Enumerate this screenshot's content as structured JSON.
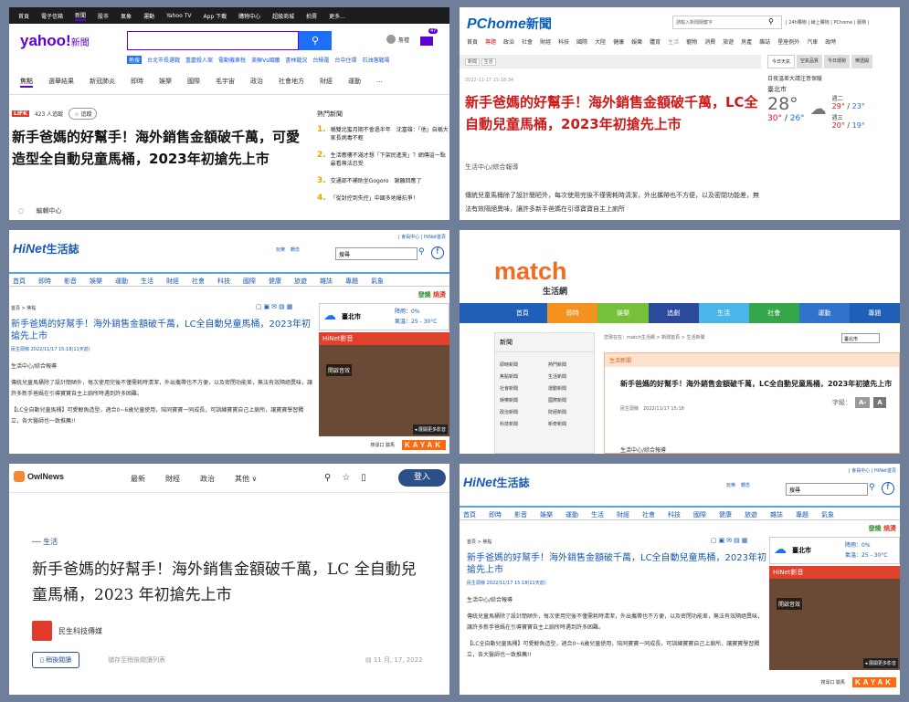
{
  "headline": "新手爸媽的好幫手！海外銷售金額破千萬，LC全自動兒童馬桶，2023年初搶先上市",
  "yahoo": {
    "topbar": [
      "首頁",
      "電子信箱",
      "新聞",
      "股市",
      "氣象",
      "運動",
      "Yahoo TV",
      "App 下載",
      "購物中心",
      "超級商城",
      "拍賣",
      "更多..."
    ],
    "logo": "yahoo!",
    "logo_sub": "新聞",
    "search_icon": "search-icon",
    "quick_hot": "熱搜",
    "quick_links": [
      "台北市長選戰",
      "重慶殺人案",
      "電動機車稅",
      "美聯Vs國鵬",
      "書林戰況",
      "台積電",
      "台中住環",
      "石油落戰場"
    ],
    "user": "詹禮",
    "mail_badge": "47",
    "nav": [
      "焦點",
      "選舉結果",
      "新冠肺炎",
      "即時",
      "娛樂",
      "國際",
      "毛宇宙",
      "政治",
      "社會地方",
      "財經",
      "運動",
      "..."
    ],
    "brand": "LIFK",
    "reads": "423 人追蹤",
    "follow": "☆ 追蹤",
    "title": "新手爸媽的好幫手！海外銷售金額破千萬，可愛造型全自動兒童馬桶，2023年初搶先上市",
    "hot_header": "熱門新聞",
    "hot": [
      {
        "n": "1.",
        "t": "稱雙北蜜月期不會過半年　沈富雄：「他」自稱大家長病毒不輕"
      },
      {
        "n": "2.",
        "t": "生活應樓不滿才想「下架民進黨」？網傳這一點最看無法忍受"
      },
      {
        "n": "3.",
        "t": "交通部不補助坐Gogoro　謝願回應了"
      },
      {
        "n": "4.",
        "t": "「從封控到失控」中國多地爆抗爭！"
      }
    ],
    "editor": "編輯中心"
  },
  "pchome": {
    "logo": "PChome",
    "logo_sub": "新聞",
    "search_placeholder": "請輸入新聞關鍵字",
    "toplinks": "| 24h購物 | 線上購物 | PChome | 服務 |",
    "nav": [
      "首頁",
      "專題",
      "政治",
      "社會",
      "財經",
      "科技",
      "國際",
      "大陸",
      "健康",
      "娛樂",
      "體育",
      "生活",
      "寵物",
      "消費",
      "旅遊",
      "房產",
      "雜誌",
      "星座例外",
      "汽車",
      "政時"
    ],
    "bread": [
      "新聞",
      "生活"
    ],
    "date": "2022-11-17 15:18:34",
    "title": "新手爸媽的好幫手！海外銷售金額破千萬，LC全自動兒童馬桶，2023年初搶先上市",
    "source": "生活中心/綜合報導",
    "body": "傳統兒童馬桶除了設計簡陋外，每次使用完後不僅需耗時清潔，外出攜帶也不方便，以及密閉功能差，無法有效隔絕異味，讓許多新手爸媽在引導寶寶自主上廁所",
    "wtabs": [
      "今日天氣",
      "空氣品質",
      "今日運勢",
      "樂透開"
    ],
    "wx_note": "日夜溫差大請注意保暖",
    "city": "臺北市",
    "temp": "28°",
    "range_hi": "30°",
    "range_lo": "26°",
    "d2": "週二",
    "d2_hi": "29°",
    "d2_lo": "23°",
    "d3": "週三",
    "d3_hi": "20°",
    "d3_lo": "19°"
  },
  "hinet": {
    "logo": "HiNet",
    "logo_sub": "生活誌",
    "toplinks": "| 會員中心 | HiNet首頁",
    "fun": "玩樂",
    "xfer": "轉念",
    "search": "搜尋",
    "nav": [
      "首頁",
      "即時",
      "影音",
      "娛樂",
      "運動",
      "生活",
      "財經",
      "社會",
      "科技",
      "國際",
      "健康",
      "旅遊",
      "雜誌",
      "專題",
      "氣象"
    ],
    "green": [
      "發燒",
      "燒燙"
    ],
    "bread": "首頁 > 焦點",
    "title": "新手爸媽的好幫手！海外銷售金額破千萬，LC全自動兒童馬桶，2023年初搶先上市",
    "date": "民生頭條 2022/11/17 15:18(11天前)",
    "src": "生活中心/綜合報導",
    "body1": "傳統兒童馬桶除了設計簡陋外，每次使用完後不僅需耗時清潔，外出攜帶也不方便，以及密閉功能差，無法有效隔絕異味，讓許多新手爸媽在引導寶寶自主上廁所時遇到許多困難。",
    "body2": "【LC全自動兒童馬桶】可愛鯨魚造型，適合0~6歲兒童使用，陪同寶寶一同成長，可訓練寶寶自己上廁所，讓寶寶學習獨立，各大醫師也一致推薦!!",
    "wx_city": "臺北市",
    "wx_rain": "降雨：0%",
    "wx_temp": "氣溫：25 - 30°C",
    "video_header": "HiNet影音",
    "video_label": "開啟音效",
    "video_more": "◂ 展開更多影音",
    "ad": "KAYAK",
    "ad_note": "搜尋口 驗馬"
  },
  "match": {
    "logo": "match",
    "logo_sub": "生活網",
    "nav": [
      {
        "t": "首頁",
        "c": "#1f5fb8"
      },
      {
        "t": "即時",
        "c": "#f4921f"
      },
      {
        "t": "娛樂",
        "c": "#77c03a"
      },
      {
        "t": "追劇",
        "c": "#2c4a9b"
      },
      {
        "t": "生活",
        "c": "#4ab5e8"
      },
      {
        "t": "社會",
        "c": "#35a64a"
      },
      {
        "t": "運動",
        "c": "#2f73cc"
      },
      {
        "t": "專題",
        "c": "#1f5fb8"
      }
    ],
    "left_header": "新聞",
    "left_items": [
      "即時新聞",
      "熱門新聞",
      "焦點新聞",
      "生活新聞",
      "社會新聞",
      "運動新聞",
      "娛樂新聞",
      "國際新聞",
      "政治新聞",
      "財經新聞",
      "科技新聞",
      "新奇新聞"
    ],
    "bread": "您現在在：match生活網 > 新聞首頁 > 生活新聞",
    "city": "臺北市",
    "box_header": "生活新聞",
    "title": "新手爸媽的好幫手！海外銷售金額破千萬，LC全自動兒童馬桶，2023年初搶先上市",
    "date": "民生頭條　2022/11/17 15:18",
    "fs_label": "字級：",
    "src": "生活中心/綜合報導"
  },
  "owl": {
    "logo": "OwlNews",
    "nav": [
      "最新",
      "財經",
      "政治",
      "其他 ∨"
    ],
    "login": "登入",
    "category": "── 生活",
    "title": "新手爸媽的好幫手！海外銷售金額破千萬，LC 全自動兒童馬桶，2023 年初搶先上市",
    "publisher": "民生科技傳媒",
    "later_btn": "稍後閱讀",
    "later_desc": "儲存至稍後閱讀列表",
    "date": "11 月, 17, 2022"
  }
}
